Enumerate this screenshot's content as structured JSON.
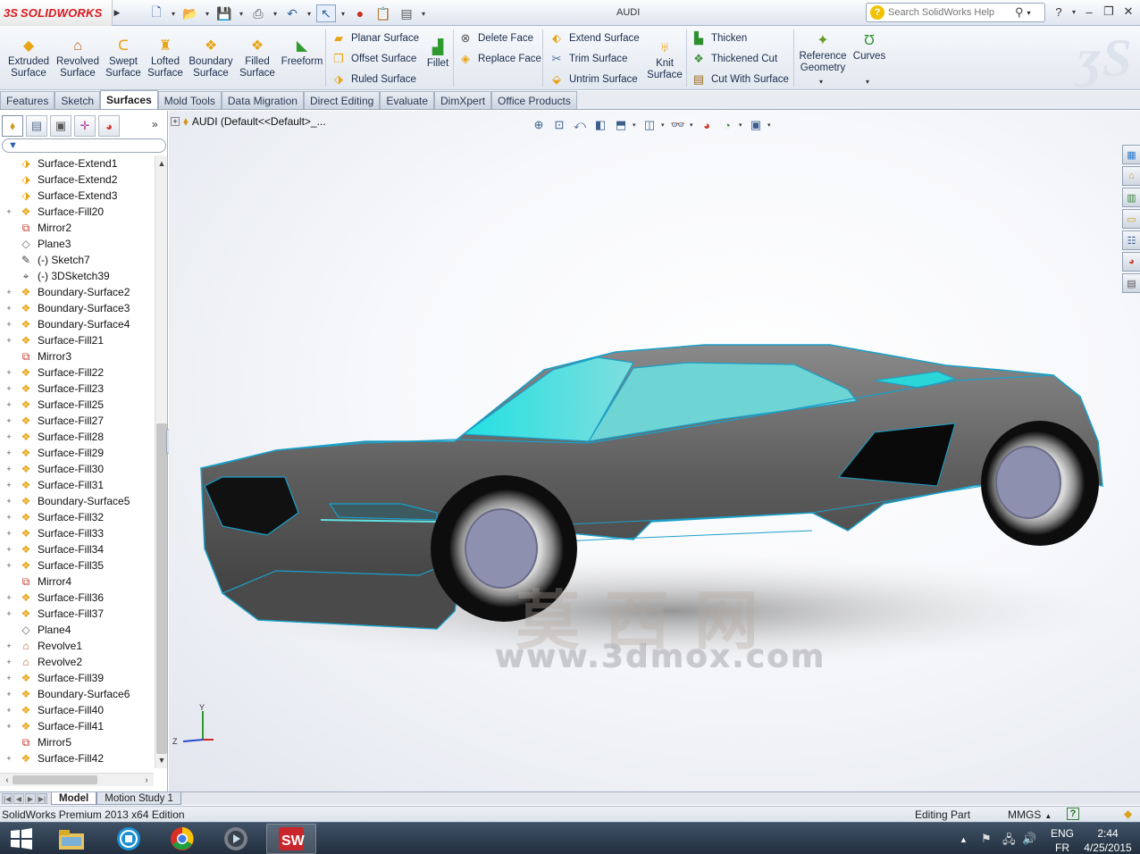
{
  "app": {
    "brand_ds": "3S",
    "brand_name": "SOLIDWORKS",
    "window_title": "AUDI",
    "search_placeholder": "Search SolidWorks Help"
  },
  "ribbon": {
    "big_buttons": [
      {
        "id": "extruded-surface",
        "label1": "Extruded",
        "label2": "Surface",
        "icon": "extruded-surface-icon"
      },
      {
        "id": "revolved-surface",
        "label1": "Revolved",
        "label2": "Surface",
        "icon": "revolved-surface-icon"
      },
      {
        "id": "swept-surface",
        "label1": "Swept",
        "label2": "Surface",
        "icon": "swept-surface-icon"
      },
      {
        "id": "lofted-surface",
        "label1": "Lofted",
        "label2": "Surface",
        "icon": "lofted-surface-icon"
      },
      {
        "id": "boundary-surface",
        "label1": "Boundary",
        "label2": "Surface",
        "icon": "boundary-surface-icon"
      },
      {
        "id": "filled-surface",
        "label1": "Filled",
        "label2": "Surface",
        "icon": "filled-surface-icon"
      },
      {
        "id": "freeform",
        "label1": "Freeform",
        "label2": "",
        "icon": "freeform-icon"
      }
    ],
    "col1": [
      "Planar Surface",
      "Offset Surface",
      "Ruled Surface"
    ],
    "fillet": "Fillet",
    "col2": [
      "Delete Face",
      "Replace Face"
    ],
    "col3": [
      "Extend Surface",
      "Trim Surface",
      "Untrim Surface"
    ],
    "knit": {
      "label1": "Knit",
      "label2": "Surface"
    },
    "col4": [
      "Thicken",
      "Thickened Cut",
      "Cut With Surface"
    ],
    "reference_geometry": {
      "label1": "Reference",
      "label2": "Geometry"
    },
    "curves": "Curves"
  },
  "command_tabs": [
    "Features",
    "Sketch",
    "Surfaces",
    "Mold Tools",
    "Data Migration",
    "Direct Editing",
    "Evaluate",
    "DimXpert",
    "Office Products"
  ],
  "active_command_tab": "Surfaces",
  "tree": {
    "root_label": "AUDI  (Default<<Default>_...",
    "items": [
      {
        "label": "Surface-Extend1",
        "icon": "surface-extend-icon",
        "expandable": false
      },
      {
        "label": "Surface-Extend2",
        "icon": "surface-extend-icon",
        "expandable": false
      },
      {
        "label": "Surface-Extend3",
        "icon": "surface-extend-icon",
        "expandable": false
      },
      {
        "label": "Surface-Fill20",
        "icon": "surface-fill-icon",
        "expandable": true
      },
      {
        "label": "Mirror2",
        "icon": "mirror-icon",
        "expandable": false
      },
      {
        "label": "Plane3",
        "icon": "plane-icon",
        "expandable": false
      },
      {
        "label": "(-) Sketch7",
        "icon": "sketch-icon",
        "expandable": false
      },
      {
        "label": "(-) 3DSketch39",
        "icon": "3dsketch-icon",
        "expandable": false
      },
      {
        "label": "Boundary-Surface2",
        "icon": "boundary-surface-icon",
        "expandable": true
      },
      {
        "label": "Boundary-Surface3",
        "icon": "boundary-surface-icon",
        "expandable": true
      },
      {
        "label": "Boundary-Surface4",
        "icon": "boundary-surface-icon",
        "expandable": true
      },
      {
        "label": "Surface-Fill21",
        "icon": "surface-fill-icon",
        "expandable": true
      },
      {
        "label": "Mirror3",
        "icon": "mirror-icon",
        "expandable": false
      },
      {
        "label": "Surface-Fill22",
        "icon": "surface-fill-icon",
        "expandable": true
      },
      {
        "label": "Surface-Fill23",
        "icon": "surface-fill-icon",
        "expandable": true
      },
      {
        "label": "Surface-Fill25",
        "icon": "surface-fill-icon",
        "expandable": true
      },
      {
        "label": "Surface-Fill27",
        "icon": "surface-fill-icon",
        "expandable": true
      },
      {
        "label": "Surface-Fill28",
        "icon": "surface-fill-icon",
        "expandable": true
      },
      {
        "label": "Surface-Fill29",
        "icon": "surface-fill-icon",
        "expandable": true
      },
      {
        "label": "Surface-Fill30",
        "icon": "surface-fill-icon",
        "expandable": true
      },
      {
        "label": "Surface-Fill31",
        "icon": "surface-fill-icon",
        "expandable": true
      },
      {
        "label": "Boundary-Surface5",
        "icon": "boundary-surface-icon",
        "expandable": true
      },
      {
        "label": "Surface-Fill32",
        "icon": "surface-fill-icon",
        "expandable": true
      },
      {
        "label": "Surface-Fill33",
        "icon": "surface-fill-icon",
        "expandable": true
      },
      {
        "label": "Surface-Fill34",
        "icon": "surface-fill-icon",
        "expandable": true
      },
      {
        "label": "Surface-Fill35",
        "icon": "surface-fill-icon",
        "expandable": true
      },
      {
        "label": "Mirror4",
        "icon": "mirror-icon",
        "expandable": false
      },
      {
        "label": "Surface-Fill36",
        "icon": "surface-fill-icon",
        "expandable": true
      },
      {
        "label": "Surface-Fill37",
        "icon": "surface-fill-icon",
        "expandable": true
      },
      {
        "label": "Plane4",
        "icon": "plane-icon",
        "expandable": false
      },
      {
        "label": "Revolve1",
        "icon": "revolve-icon",
        "expandable": true
      },
      {
        "label": "Revolve2",
        "icon": "revolve-icon",
        "expandable": true
      },
      {
        "label": "Surface-Fill39",
        "icon": "surface-fill-icon",
        "expandable": true
      },
      {
        "label": "Boundary-Surface6",
        "icon": "boundary-surface-icon",
        "expandable": true
      },
      {
        "label": "Surface-Fill40",
        "icon": "surface-fill-icon",
        "expandable": true
      },
      {
        "label": "Surface-Fill41",
        "icon": "surface-fill-icon",
        "expandable": true
      },
      {
        "label": "Mirror5",
        "icon": "mirror-icon",
        "expandable": false
      },
      {
        "label": "Surface-Fill42",
        "icon": "surface-fill-icon",
        "expandable": true
      }
    ]
  },
  "graphics": {
    "watermark_cn": "莫西网",
    "watermark_url": "www.3dmox.com",
    "triad_y": "Y",
    "triad_z": "Z",
    "colors": {
      "body": "#5a5a5a",
      "glass": "#33d6d9",
      "edges": "#1aa0c8",
      "wheel_rim": "#8e90b0"
    }
  },
  "model_tabs": [
    "Model",
    "Motion Study 1"
  ],
  "active_model_tab": "Model",
  "status": {
    "edition": "SolidWorks Premium 2013 x64 Edition",
    "mode": "Editing Part",
    "units": "MMGS"
  },
  "taskbar": {
    "lang1": "ENG",
    "lang2": "FR",
    "time": "2:44",
    "date": "4/25/2015",
    "apps": [
      "file-explorer-icon",
      "media-center-icon",
      "chrome-icon",
      "media-player-icon",
      "solidworks-icon"
    ]
  }
}
